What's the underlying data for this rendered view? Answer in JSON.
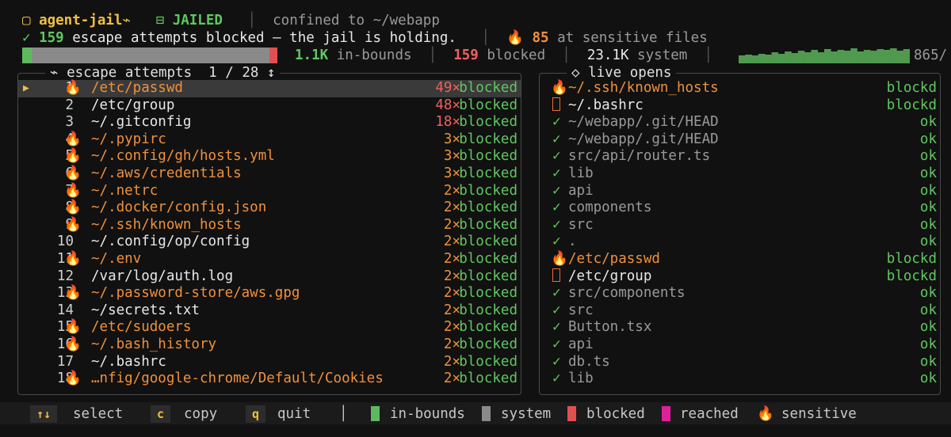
{
  "header": {
    "app_icon": "square-outline-icon",
    "app_name": "agent-jail",
    "tilde": "⌁",
    "jail_icon": "⊟",
    "status": "JAILED",
    "divider": "│",
    "confined_label": "confined to ~/webapp",
    "check": "✓",
    "blocked_count": "159",
    "blocked_text": " escape attempts blocked — the jail is holding.",
    "sensitive_icon": "🔥",
    "sensitive_count": "85",
    "sensitive_text": " at sensitive files"
  },
  "stats": {
    "inbounds_value": "1.1K",
    "inbounds_label": " in-bounds",
    "blocked_value": "159",
    "blocked_label": " blocked",
    "system_value": "23.1K",
    "system_label": " system",
    "spark_count": "865/",
    "ratios": {
      "inbounds": 0.04,
      "system": 0.93,
      "blocked": 0.03
    },
    "sparkline": [
      0.5,
      0.55,
      0.5,
      0.6,
      0.55,
      0.7,
      0.6,
      0.75,
      0.65,
      0.8,
      0.7,
      0.85,
      0.7,
      0.9,
      0.75,
      0.85,
      0.8,
      0.95,
      0.75,
      0.85,
      0.8,
      0.9,
      0.85,
      0.95,
      0.8,
      0.9
    ],
    "colors": {
      "inbounds": "#5fb85f",
      "system": "#8a8a8a",
      "blocked": "#e05050",
      "spark": "#4f9a4f"
    }
  },
  "escape_panel": {
    "title": "⌁ escape attempts  1 / 28 ↕",
    "rows": [
      {
        "num": "1",
        "flame": true,
        "path": "/etc/passwd",
        "count": "49×",
        "status": "blocked",
        "selected": true,
        "hot": true
      },
      {
        "num": "2",
        "flame": false,
        "path": "/etc/group",
        "count": "48×",
        "status": "blocked",
        "hot": true
      },
      {
        "num": "3",
        "flame": false,
        "path": "~/.gitconfig",
        "count": "18×",
        "status": "blocked",
        "hot": true
      },
      {
        "num": "4",
        "flame": true,
        "path": "~/.pypirc",
        "count": "3×",
        "status": "blocked"
      },
      {
        "num": "5",
        "flame": true,
        "path": "~/.config/gh/hosts.yml",
        "count": "3×",
        "status": "blocked"
      },
      {
        "num": "6",
        "flame": true,
        "path": "~/.aws/credentials",
        "count": "3×",
        "status": "blocked"
      },
      {
        "num": "7",
        "flame": true,
        "path": "~/.netrc",
        "count": "2×",
        "status": "blocked"
      },
      {
        "num": "8",
        "flame": true,
        "path": "~/.docker/config.json",
        "count": "2×",
        "status": "blocked"
      },
      {
        "num": "9",
        "flame": true,
        "path": "~/.ssh/known_hosts",
        "count": "2×",
        "status": "blocked"
      },
      {
        "num": "10",
        "flame": false,
        "path": "~/.config/op/config",
        "count": "2×",
        "status": "blocked"
      },
      {
        "num": "11",
        "flame": true,
        "path": "~/.env",
        "count": "2×",
        "status": "blocked"
      },
      {
        "num": "12",
        "flame": false,
        "path": "/var/log/auth.log",
        "count": "2×",
        "status": "blocked"
      },
      {
        "num": "13",
        "flame": true,
        "path": "~/.password-store/aws.gpg",
        "count": "2×",
        "status": "blocked"
      },
      {
        "num": "14",
        "flame": false,
        "path": "~/secrets.txt",
        "count": "2×",
        "status": "blocked"
      },
      {
        "num": "15",
        "flame": true,
        "path": "/etc/sudoers",
        "count": "2×",
        "status": "blocked"
      },
      {
        "num": "16",
        "flame": true,
        "path": "~/.bash_history",
        "count": "2×",
        "status": "blocked"
      },
      {
        "num": "17",
        "flame": false,
        "path": "~/.bashrc",
        "count": "2×",
        "status": "blocked"
      },
      {
        "num": "18",
        "flame": true,
        "path": "…nfig/google-chrome/Default/Cookies",
        "count": "2×",
        "status": "blocked"
      }
    ]
  },
  "live_panel": {
    "title": "◇ live opens",
    "rows": [
      {
        "mark": "flame",
        "path": "~/.ssh/known_hosts",
        "status": "blockd"
      },
      {
        "mark": "box",
        "path": "~/.bashrc",
        "status": "blockd"
      },
      {
        "mark": "check",
        "path": "~/webapp/.git/HEAD",
        "status": "ok"
      },
      {
        "mark": "check",
        "path": "~/webapp/.git/HEAD",
        "status": "ok"
      },
      {
        "mark": "check",
        "path": "src/api/router.ts",
        "status": "ok"
      },
      {
        "mark": "check",
        "path": "lib",
        "status": "ok"
      },
      {
        "mark": "check",
        "path": "api",
        "status": "ok"
      },
      {
        "mark": "check",
        "path": "components",
        "status": "ok"
      },
      {
        "mark": "check",
        "path": "src",
        "status": "ok"
      },
      {
        "mark": "check",
        "path": ".",
        "status": "ok"
      },
      {
        "mark": "flame",
        "path": "/etc/passwd",
        "status": "blockd"
      },
      {
        "mark": "box",
        "path": "/etc/group",
        "status": "blockd"
      },
      {
        "mark": "check",
        "path": "src/components",
        "status": "ok"
      },
      {
        "mark": "check",
        "path": "src",
        "status": "ok"
      },
      {
        "mark": "check",
        "path": "Button.tsx",
        "status": "ok"
      },
      {
        "mark": "check",
        "path": "api",
        "status": "ok"
      },
      {
        "mark": "check",
        "path": "db.ts",
        "status": "ok"
      },
      {
        "mark": "check",
        "path": "lib",
        "status": "ok"
      }
    ]
  },
  "footer": {
    "select_key": "↑↓",
    "select_label": "select",
    "copy_key": "c",
    "copy_label": "copy",
    "quit_key": "q",
    "quit_label": "quit",
    "divider": "│",
    "legend": [
      {
        "label": "in-bounds",
        "color": "#5fb85f"
      },
      {
        "label": "system",
        "color": "#8a8a8a"
      },
      {
        "label": "blocked",
        "color": "#e05050"
      },
      {
        "label": "reached",
        "color": "#e0209a"
      }
    ],
    "sensitive_icon": "🔥",
    "sensitive_label": "sensitive"
  }
}
